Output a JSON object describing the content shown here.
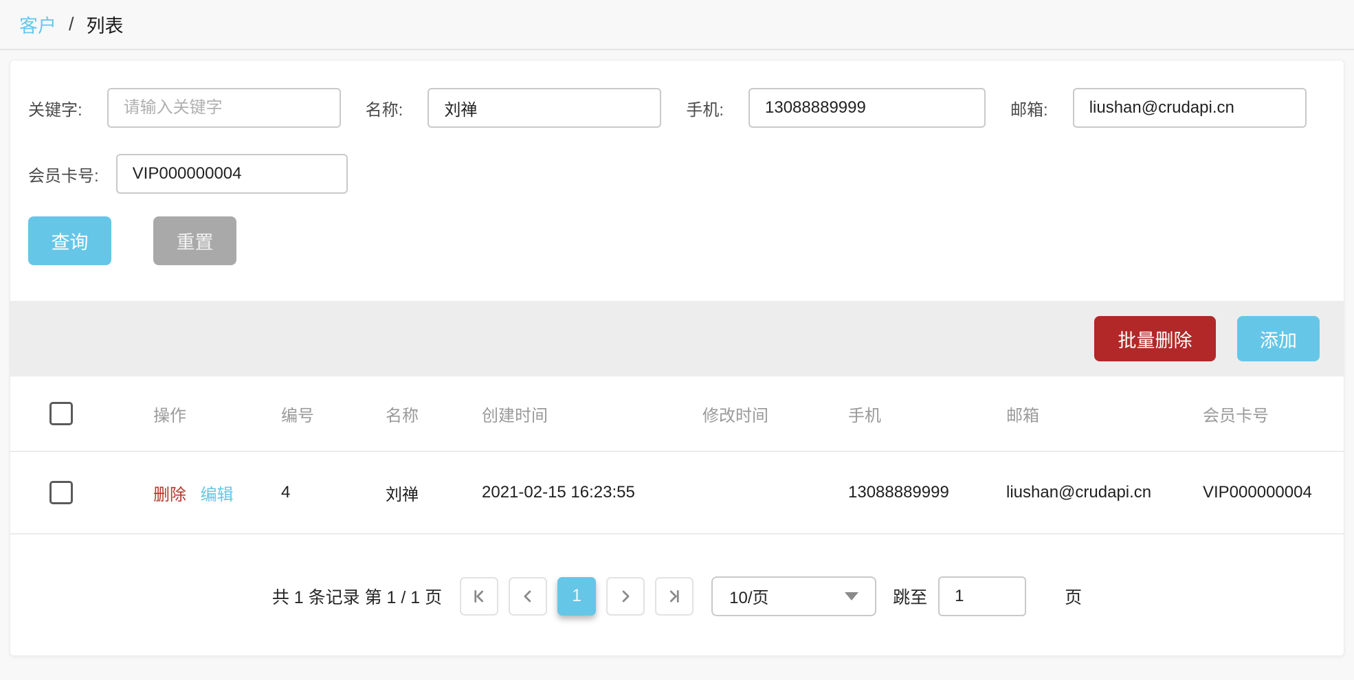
{
  "breadcrumb": {
    "parent": "客户",
    "separator": "/",
    "current": "列表"
  },
  "filters": {
    "fields": [
      {
        "label": "关键字:",
        "placeholder": "请输入关键字",
        "value": ""
      },
      {
        "label": "名称:",
        "value": "刘禅"
      },
      {
        "label": "手机:",
        "value": "13088889999"
      },
      {
        "label": "邮箱:",
        "value": "liushan@crudapi.cn"
      },
      {
        "label": "会员卡号:",
        "value": "VIP000000004"
      }
    ],
    "search_label": "查询",
    "reset_label": "重置"
  },
  "toolbar": {
    "batch_delete_label": "批量删除",
    "add_label": "添加"
  },
  "table": {
    "columns": [
      "操作",
      "编号",
      "名称",
      "创建时间",
      "修改时间",
      "手机",
      "邮箱",
      "会员卡号"
    ],
    "rows": [
      {
        "delete_label": "删除",
        "edit_label": "编辑",
        "id": "4",
        "name": "刘禅",
        "created": "2021-02-15 16:23:55",
        "modified": "",
        "phone": "13088889999",
        "email": "liushan@crudapi.cn",
        "card": "VIP000000004"
      }
    ]
  },
  "pagination": {
    "summary": "共 1 条记录 第 1 / 1 页",
    "current_page": "1",
    "page_size": "10/页",
    "jump_label": "跳至",
    "jump_value": "1",
    "page_unit": "页"
  },
  "colors": {
    "accent_blue": "#66c6e7",
    "breadcrumb_blue": "#69c7ec",
    "danger_red": "#b22828",
    "delete_link_red": "#b5362b",
    "toolbar_gray": "#ededed"
  }
}
